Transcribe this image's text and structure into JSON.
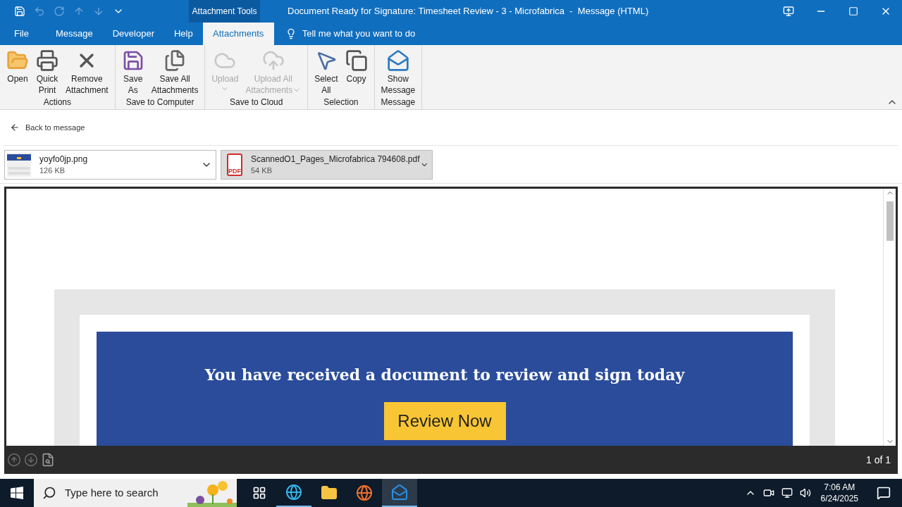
{
  "window": {
    "title": "Document Ready for Signature: Timesheet Review - 3 - Microfabrica  -  Message (HTML)",
    "context_tab_group": "Attachment Tools"
  },
  "quick_access": [
    {
      "kind": "save",
      "disabled": false
    },
    {
      "kind": "undo",
      "disabled": true
    },
    {
      "kind": "redo",
      "disabled": true
    },
    {
      "kind": "up",
      "disabled": true
    },
    {
      "kind": "down",
      "disabled": true
    },
    {
      "kind": "customize",
      "disabled": false
    }
  ],
  "tabs": [
    {
      "label": "File",
      "selected": false
    },
    {
      "label": "Message",
      "selected": false
    },
    {
      "label": "Developer",
      "selected": false
    },
    {
      "label": "Help",
      "selected": false
    },
    {
      "label": "Attachments",
      "selected": true
    }
  ],
  "tell_me": {
    "placeholder": "Tell me what you want to do"
  },
  "ribbon_groups": [
    {
      "label": "Actions",
      "buttons": [
        {
          "kind": "open",
          "lines": [
            "Open"
          ],
          "disabled": false,
          "dropdown": false
        },
        {
          "kind": "print",
          "lines": [
            "Quick",
            "Print"
          ],
          "disabled": false,
          "dropdown": false
        },
        {
          "kind": "remove",
          "lines": [
            "Remove",
            "Attachment"
          ],
          "disabled": false,
          "dropdown": false
        }
      ]
    },
    {
      "label": "Save to Computer",
      "buttons": [
        {
          "kind": "save",
          "lines": [
            "Save",
            "As"
          ],
          "disabled": false,
          "dropdown": false
        },
        {
          "kind": "saveall",
          "lines": [
            "Save All",
            "Attachments"
          ],
          "disabled": false,
          "dropdown": false
        }
      ]
    },
    {
      "label": "Save to Cloud",
      "buttons": [
        {
          "kind": "upload",
          "lines": [
            "Upload"
          ],
          "disabled": true,
          "dropdown": true
        },
        {
          "kind": "uploadall",
          "lines": [
            "Upload All",
            "Attachments"
          ],
          "disabled": true,
          "dropdown": true
        }
      ]
    },
    {
      "label": "Selection",
      "buttons": [
        {
          "kind": "select",
          "lines": [
            "Select",
            "All"
          ],
          "disabled": false,
          "dropdown": false
        },
        {
          "kind": "copy",
          "lines": [
            "Copy"
          ],
          "disabled": false,
          "dropdown": false
        }
      ]
    },
    {
      "label": "Message",
      "buttons": [
        {
          "kind": "show",
          "lines": [
            "Show",
            "Message"
          ],
          "disabled": false,
          "dropdown": false
        }
      ]
    }
  ],
  "back_link": "Back to message",
  "attachments": [
    {
      "name": "yoyfo0jp.png",
      "size": "126 KB",
      "selected": false
    },
    {
      "kind": "pdf",
      "name": "ScannedO1_Pages_Microfabrica 794608.pdf",
      "size": "54 KB",
      "selected": true
    }
  ],
  "pdf_icon_label": "PDF",
  "preview": {
    "heading": "You have received a document to review and sign today",
    "button": "Review Now",
    "page_count": "1 of 1"
  },
  "taskbar": {
    "search_placeholder": "Type here to search",
    "time": "7:06 AM",
    "date": "6/24/2025"
  }
}
